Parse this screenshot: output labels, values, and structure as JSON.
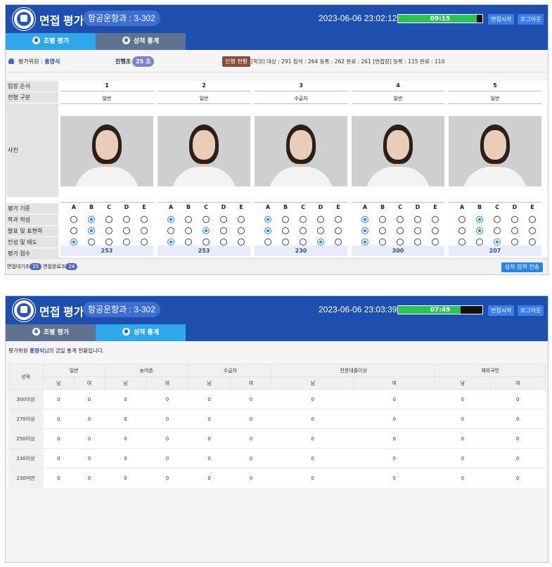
{
  "window1": {
    "title": "면접 평가",
    "dept": "항공운항과 : 3-302",
    "datetime": "2023-06-06 23:02:12",
    "timer": "09:15",
    "timer_progress": 0.93,
    "btn_start": "면접시작",
    "btn_logout": "로그아웃",
    "tab_group": "조별 평가",
    "tab_stats": "성적 통계",
    "evaluator_label": "평가위원 :",
    "evaluator_name": "홍영식",
    "group_label": "진행조",
    "group_value": "25 조",
    "progress_label": "진행 현황",
    "progress_text": "[학과] 대상 : 291  참석 : 264  등록 : 262  완료 : 261   [면접장] 등록 : 115  완료 : 110",
    "row_labels": {
      "order": "입장 순서",
      "type": "전형 구분",
      "photo": "사진",
      "criteria": "평가 기준",
      "r1": "학과 적성",
      "r2": "발표 및 표현력",
      "r3": "인성 및 태도",
      "score": "평가 점수"
    },
    "grade_letters": [
      "A",
      "B",
      "C",
      "D",
      "E"
    ],
    "candidates": [
      {
        "num": "1",
        "type": "일반",
        "sel": [
          1,
          1,
          0
        ],
        "score": "253"
      },
      {
        "num": "2",
        "type": "일반",
        "sel": [
          0,
          2,
          0
        ],
        "score": "253"
      },
      {
        "num": "3",
        "type": "수급자",
        "sel": [
          0,
          0,
          3
        ],
        "score": "230"
      },
      {
        "num": "4",
        "type": "일반",
        "sel": [
          0,
          0,
          0
        ],
        "score": "300"
      },
      {
        "num": "5",
        "type": "일반",
        "sel": [
          1,
          1,
          2
        ],
        "score": "207"
      }
    ],
    "foot_wait_label": "면접대기조",
    "foot_wait": "25",
    "foot_done_label": "면접완료조",
    "foot_done": "24",
    "submit": "성적 입력 전송"
  },
  "window2": {
    "title": "면접 평가",
    "dept": "항공운항과 : 3-302",
    "datetime": "2023-06-06 23:03:39",
    "timer": "07:49",
    "timer_progress": 0.74,
    "btn_start": "면접시작",
    "btn_logout": "로그아웃",
    "tab_group": "조별 평가",
    "tab_stats": "성적 통계",
    "msg_prefix": "평가위원 ",
    "msg_name": "홍영식",
    "msg_suffix": "님의 금일 통계 현황입니다.",
    "table": {
      "corner": "성적",
      "groups": [
        "일반",
        "농어촌",
        "수급자",
        "전문대졸이상",
        "재외국민"
      ],
      "male": "남",
      "female": "여",
      "rows": [
        {
          "label": "300이상",
          "values": [
            "0",
            "0",
            "0",
            "0",
            "0",
            "0",
            "0",
            "0",
            "0",
            "0"
          ]
        },
        {
          "label": "270이상",
          "values": [
            "0",
            "0",
            "0",
            "0",
            "0",
            "0",
            "0",
            "0",
            "0",
            "0"
          ]
        },
        {
          "label": "250이상",
          "values": [
            "0",
            "0",
            "0",
            "0",
            "0",
            "0",
            "0",
            "0",
            "0",
            "0"
          ]
        },
        {
          "label": "230이상",
          "values": [
            "0",
            "0",
            "0",
            "0",
            "0",
            "0",
            "0",
            "0",
            "0",
            "0"
          ]
        },
        {
          "label": "230미만",
          "values": [
            "0",
            "0",
            "0",
            "0",
            "0",
            "0",
            "0",
            "0",
            "0",
            "0"
          ]
        }
      ]
    }
  }
}
